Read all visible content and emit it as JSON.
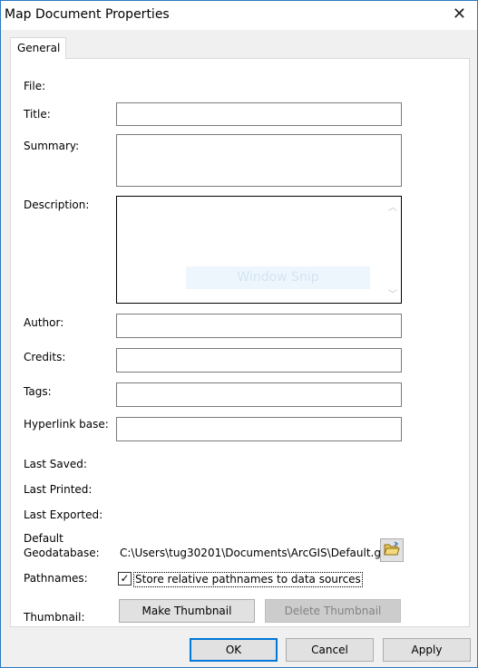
{
  "window": {
    "title": "Map Document Properties",
    "close_icon": "close-icon"
  },
  "tabs": [
    {
      "label": "General"
    }
  ],
  "fields": {
    "file": "File:",
    "title": "Title:",
    "summary": "Summary:",
    "description": "Description:",
    "author": "Author:",
    "credits": "Credits:",
    "tags": "Tags:",
    "hyperlink_base": "Hyperlink base:",
    "last_saved": "Last Saved:",
    "last_printed": "Last Printed:",
    "last_exported": "Last Exported:",
    "default_gdb_1": "Default",
    "default_gdb_2": "Geodatabase:",
    "default_gdb_value": "C:\\Users\\tug30201\\Documents\\ArcGIS\\Default.g",
    "pathnames": "Pathnames:",
    "pathnames_checkbox": "Store relative pathnames to data sources",
    "thumbnail": "Thumbnail:"
  },
  "values": {
    "title": "",
    "summary": "",
    "description": "",
    "author": "",
    "credits": "",
    "tags": "",
    "hyperlink_base": "",
    "pathnames_checked": true
  },
  "overlay": "Window Snip",
  "buttons": {
    "make_thumbnail": "Make Thumbnail",
    "delete_thumbnail": "Delete Thumbnail",
    "ok": "OK",
    "cancel": "Cancel",
    "apply": "Apply"
  }
}
